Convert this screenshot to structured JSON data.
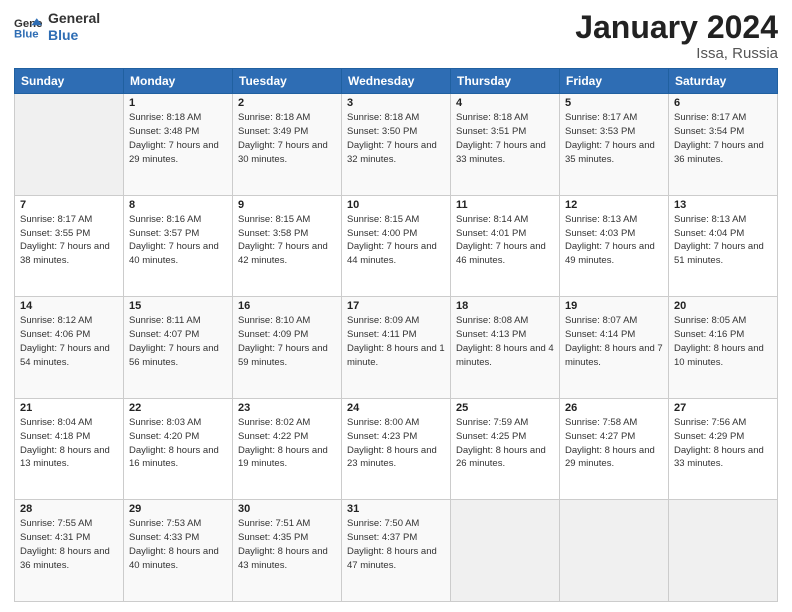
{
  "header": {
    "logo_line1": "General",
    "logo_line2": "Blue",
    "month": "January 2024",
    "location": "Issa, Russia"
  },
  "weekdays": [
    "Sunday",
    "Monday",
    "Tuesday",
    "Wednesday",
    "Thursday",
    "Friday",
    "Saturday"
  ],
  "weeks": [
    [
      {
        "day": "",
        "sunrise": "",
        "sunset": "",
        "daylight": ""
      },
      {
        "day": "1",
        "sunrise": "Sunrise: 8:18 AM",
        "sunset": "Sunset: 3:48 PM",
        "daylight": "Daylight: 7 hours and 29 minutes."
      },
      {
        "day": "2",
        "sunrise": "Sunrise: 8:18 AM",
        "sunset": "Sunset: 3:49 PM",
        "daylight": "Daylight: 7 hours and 30 minutes."
      },
      {
        "day": "3",
        "sunrise": "Sunrise: 8:18 AM",
        "sunset": "Sunset: 3:50 PM",
        "daylight": "Daylight: 7 hours and 32 minutes."
      },
      {
        "day": "4",
        "sunrise": "Sunrise: 8:18 AM",
        "sunset": "Sunset: 3:51 PM",
        "daylight": "Daylight: 7 hours and 33 minutes."
      },
      {
        "day": "5",
        "sunrise": "Sunrise: 8:17 AM",
        "sunset": "Sunset: 3:53 PM",
        "daylight": "Daylight: 7 hours and 35 minutes."
      },
      {
        "day": "6",
        "sunrise": "Sunrise: 8:17 AM",
        "sunset": "Sunset: 3:54 PM",
        "daylight": "Daylight: 7 hours and 36 minutes."
      }
    ],
    [
      {
        "day": "7",
        "sunrise": "Sunrise: 8:17 AM",
        "sunset": "Sunset: 3:55 PM",
        "daylight": "Daylight: 7 hours and 38 minutes."
      },
      {
        "day": "8",
        "sunrise": "Sunrise: 8:16 AM",
        "sunset": "Sunset: 3:57 PM",
        "daylight": "Daylight: 7 hours and 40 minutes."
      },
      {
        "day": "9",
        "sunrise": "Sunrise: 8:15 AM",
        "sunset": "Sunset: 3:58 PM",
        "daylight": "Daylight: 7 hours and 42 minutes."
      },
      {
        "day": "10",
        "sunrise": "Sunrise: 8:15 AM",
        "sunset": "Sunset: 4:00 PM",
        "daylight": "Daylight: 7 hours and 44 minutes."
      },
      {
        "day": "11",
        "sunrise": "Sunrise: 8:14 AM",
        "sunset": "Sunset: 4:01 PM",
        "daylight": "Daylight: 7 hours and 46 minutes."
      },
      {
        "day": "12",
        "sunrise": "Sunrise: 8:13 AM",
        "sunset": "Sunset: 4:03 PM",
        "daylight": "Daylight: 7 hours and 49 minutes."
      },
      {
        "day": "13",
        "sunrise": "Sunrise: 8:13 AM",
        "sunset": "Sunset: 4:04 PM",
        "daylight": "Daylight: 7 hours and 51 minutes."
      }
    ],
    [
      {
        "day": "14",
        "sunrise": "Sunrise: 8:12 AM",
        "sunset": "Sunset: 4:06 PM",
        "daylight": "Daylight: 7 hours and 54 minutes."
      },
      {
        "day": "15",
        "sunrise": "Sunrise: 8:11 AM",
        "sunset": "Sunset: 4:07 PM",
        "daylight": "Daylight: 7 hours and 56 minutes."
      },
      {
        "day": "16",
        "sunrise": "Sunrise: 8:10 AM",
        "sunset": "Sunset: 4:09 PM",
        "daylight": "Daylight: 7 hours and 59 minutes."
      },
      {
        "day": "17",
        "sunrise": "Sunrise: 8:09 AM",
        "sunset": "Sunset: 4:11 PM",
        "daylight": "Daylight: 8 hours and 1 minute."
      },
      {
        "day": "18",
        "sunrise": "Sunrise: 8:08 AM",
        "sunset": "Sunset: 4:13 PM",
        "daylight": "Daylight: 8 hours and 4 minutes."
      },
      {
        "day": "19",
        "sunrise": "Sunrise: 8:07 AM",
        "sunset": "Sunset: 4:14 PM",
        "daylight": "Daylight: 8 hours and 7 minutes."
      },
      {
        "day": "20",
        "sunrise": "Sunrise: 8:05 AM",
        "sunset": "Sunset: 4:16 PM",
        "daylight": "Daylight: 8 hours and 10 minutes."
      }
    ],
    [
      {
        "day": "21",
        "sunrise": "Sunrise: 8:04 AM",
        "sunset": "Sunset: 4:18 PM",
        "daylight": "Daylight: 8 hours and 13 minutes."
      },
      {
        "day": "22",
        "sunrise": "Sunrise: 8:03 AM",
        "sunset": "Sunset: 4:20 PM",
        "daylight": "Daylight: 8 hours and 16 minutes."
      },
      {
        "day": "23",
        "sunrise": "Sunrise: 8:02 AM",
        "sunset": "Sunset: 4:22 PM",
        "daylight": "Daylight: 8 hours and 19 minutes."
      },
      {
        "day": "24",
        "sunrise": "Sunrise: 8:00 AM",
        "sunset": "Sunset: 4:23 PM",
        "daylight": "Daylight: 8 hours and 23 minutes."
      },
      {
        "day": "25",
        "sunrise": "Sunrise: 7:59 AM",
        "sunset": "Sunset: 4:25 PM",
        "daylight": "Daylight: 8 hours and 26 minutes."
      },
      {
        "day": "26",
        "sunrise": "Sunrise: 7:58 AM",
        "sunset": "Sunset: 4:27 PM",
        "daylight": "Daylight: 8 hours and 29 minutes."
      },
      {
        "day": "27",
        "sunrise": "Sunrise: 7:56 AM",
        "sunset": "Sunset: 4:29 PM",
        "daylight": "Daylight: 8 hours and 33 minutes."
      }
    ],
    [
      {
        "day": "28",
        "sunrise": "Sunrise: 7:55 AM",
        "sunset": "Sunset: 4:31 PM",
        "daylight": "Daylight: 8 hours and 36 minutes."
      },
      {
        "day": "29",
        "sunrise": "Sunrise: 7:53 AM",
        "sunset": "Sunset: 4:33 PM",
        "daylight": "Daylight: 8 hours and 40 minutes."
      },
      {
        "day": "30",
        "sunrise": "Sunrise: 7:51 AM",
        "sunset": "Sunset: 4:35 PM",
        "daylight": "Daylight: 8 hours and 43 minutes."
      },
      {
        "day": "31",
        "sunrise": "Sunrise: 7:50 AM",
        "sunset": "Sunset: 4:37 PM",
        "daylight": "Daylight: 8 hours and 47 minutes."
      },
      {
        "day": "",
        "sunrise": "",
        "sunset": "",
        "daylight": ""
      },
      {
        "day": "",
        "sunrise": "",
        "sunset": "",
        "daylight": ""
      },
      {
        "day": "",
        "sunrise": "",
        "sunset": "",
        "daylight": ""
      }
    ]
  ]
}
